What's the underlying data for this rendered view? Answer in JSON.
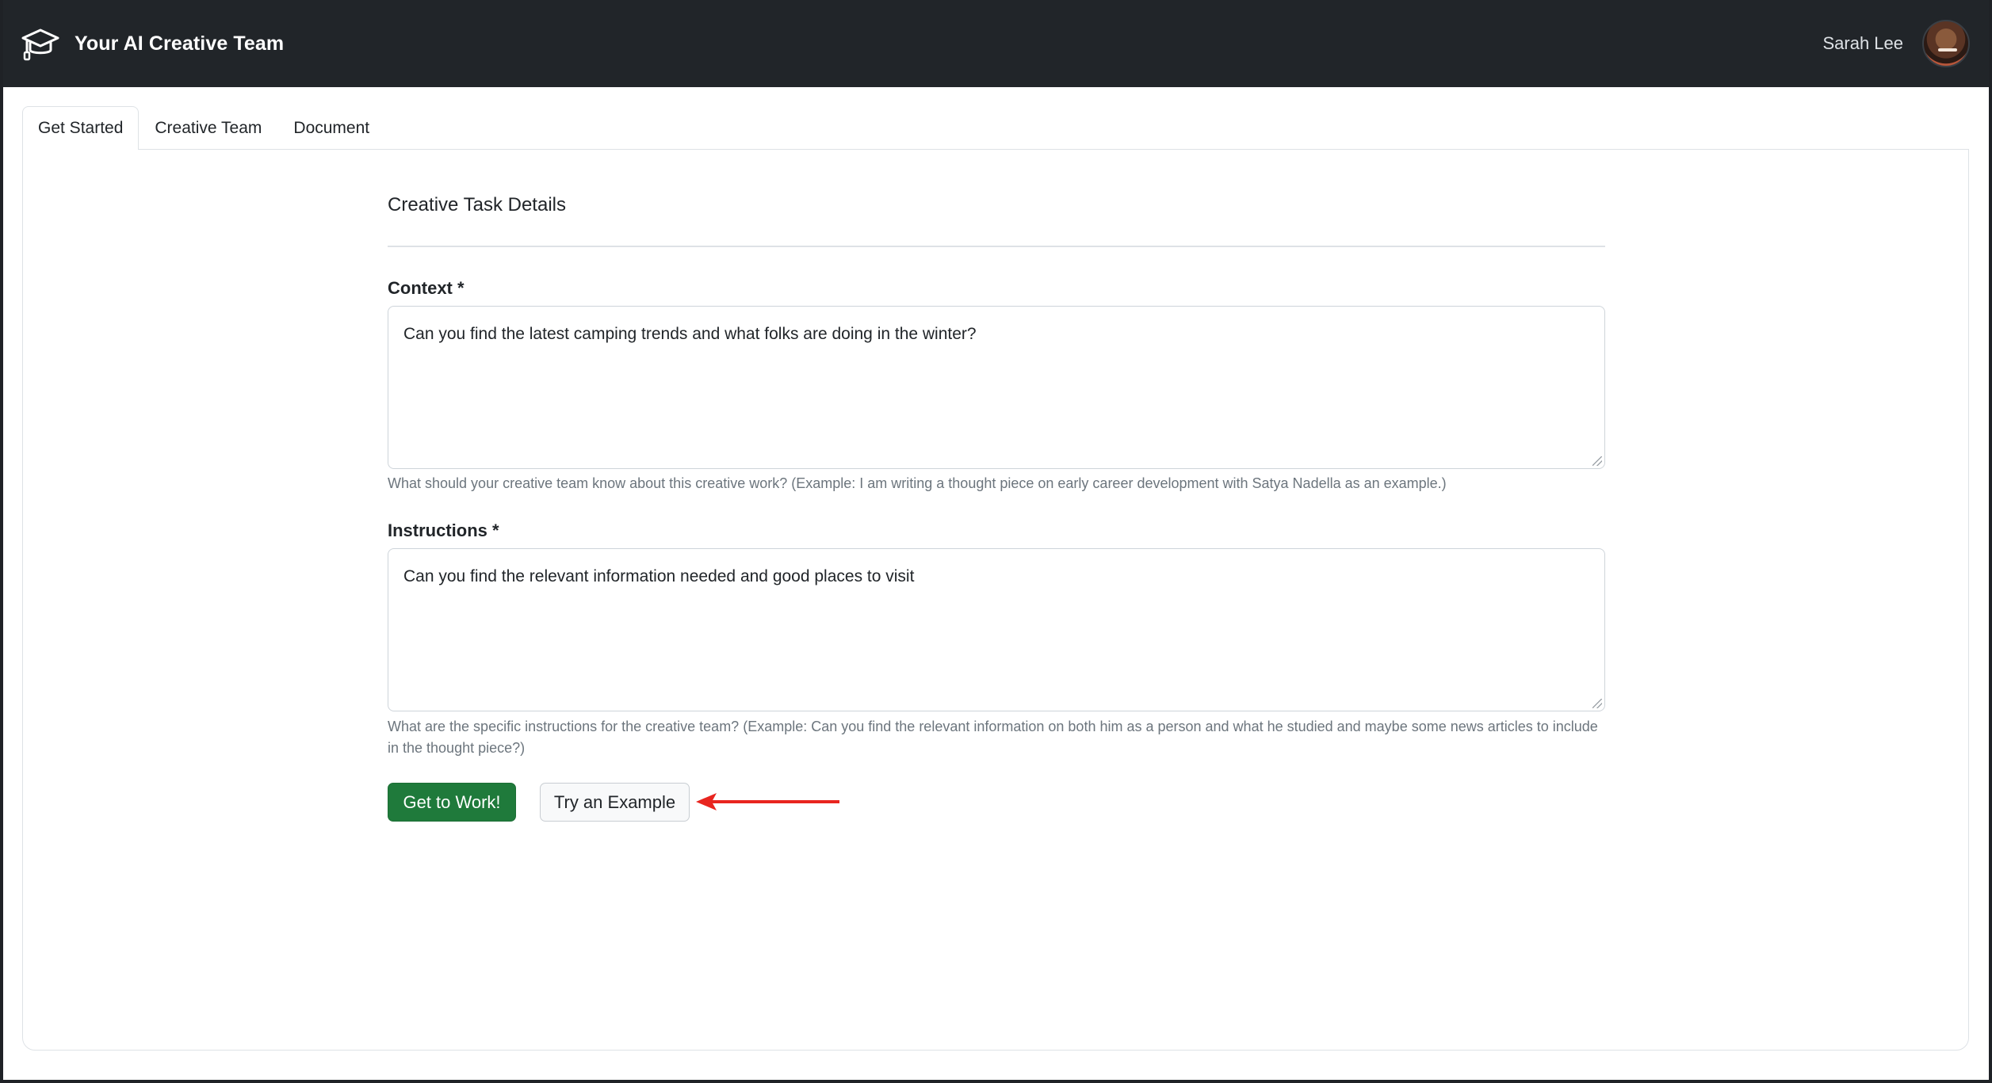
{
  "app": {
    "title": "Your AI Creative Team",
    "brand_icon": "graduation-cap-icon"
  },
  "user": {
    "name": "Sarah Lee"
  },
  "tabs": [
    {
      "label": "Get Started",
      "active": true
    },
    {
      "label": "Creative Team",
      "active": false
    },
    {
      "label": "Document",
      "active": false
    }
  ],
  "form": {
    "section_title": "Creative Task Details",
    "context": {
      "label": "Context *",
      "value": "Can you find the latest camping trends and what folks are doing in the winter?",
      "help": "What should your creative team know about this creative work? (Example: I am writing a thought piece on early career development with Satya Nadella as an example.)"
    },
    "instructions": {
      "label": "Instructions *",
      "value": "Can you find the relevant information needed and good places to visit",
      "help": "What are the specific instructions for the creative team? (Example: Can you find the relevant information on both him as a person and what he studied and maybe some news articles to include in the thought piece?)"
    },
    "buttons": {
      "primary": "Get to Work!",
      "secondary": "Try an Example"
    }
  },
  "colors": {
    "navbar": "#212529",
    "primary_button": "#1f7a3b",
    "annotation_arrow": "#e8251f"
  }
}
